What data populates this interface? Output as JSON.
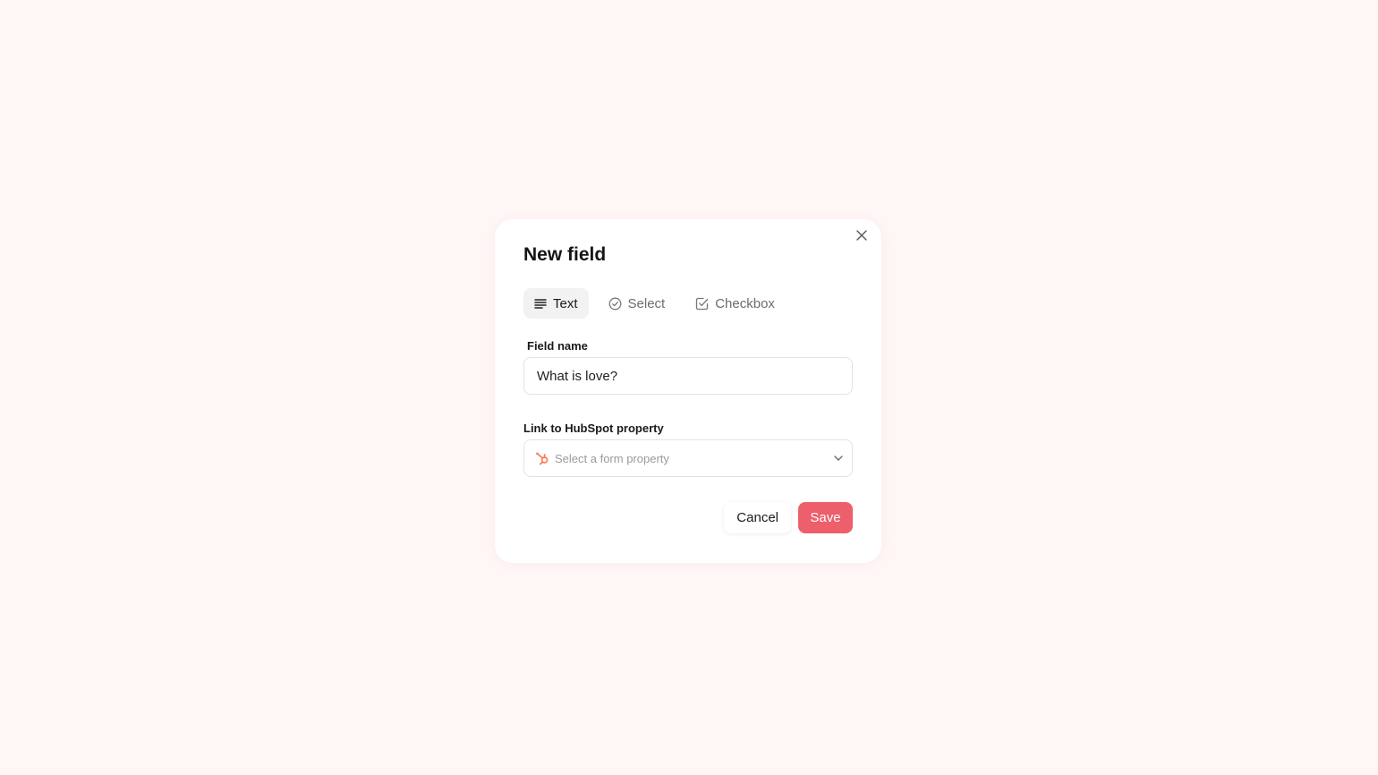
{
  "modal": {
    "title": "New field",
    "tabs": [
      {
        "label": "Text",
        "icon": "text-lines-icon",
        "active": true
      },
      {
        "label": "Select",
        "icon": "check-circle-icon",
        "active": false
      },
      {
        "label": "Checkbox",
        "icon": "checkbox-icon",
        "active": false
      }
    ],
    "field_name": {
      "label": "Field name",
      "value": "What is love?"
    },
    "hubspot": {
      "label": "Link to HubSpot property",
      "placeholder": "Select a form property",
      "icon": "hubspot-icon"
    },
    "actions": {
      "cancel_label": "Cancel",
      "save_label": "Save"
    }
  },
  "colors": {
    "background": "#fff6f6",
    "accent": "#ec5f6b",
    "hubspot": "#ff7a59"
  }
}
